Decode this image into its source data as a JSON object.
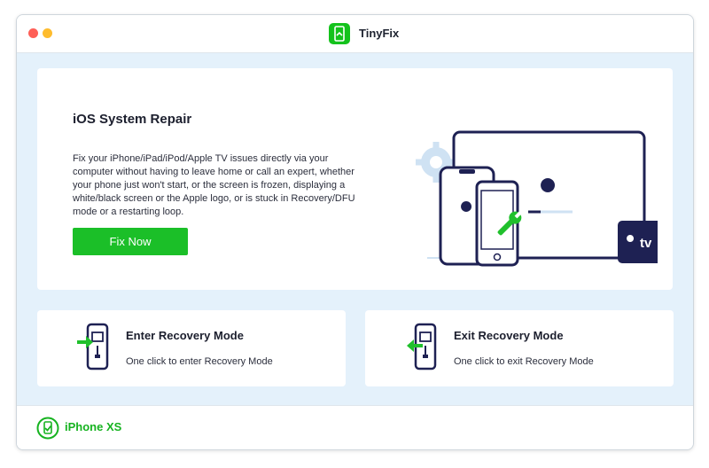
{
  "app": {
    "title": "TinyFix",
    "accent": "#1bbf28"
  },
  "main": {
    "title": "iOS System Repair",
    "description": "Fix your iPhone/iPad/iPod/Apple TV issues directly via your computer without having to leave home or call an expert, whether your phone just won't start, or the screen is frozen, displaying a white/black screen or the Apple logo, or is stuck in Recovery/DFU mode or a restarting loop.",
    "button_label": "Fix Now",
    "illustration": {
      "tv_label": "tv"
    }
  },
  "modes": {
    "enter": {
      "title": "Enter Recovery Mode",
      "subtitle": "One click to enter Recovery Mode",
      "icon": "enter-recovery-icon"
    },
    "exit": {
      "title": "Exit Recovery Mode",
      "subtitle": "One click to exit Recovery Mode",
      "icon": "exit-recovery-icon"
    }
  },
  "footer": {
    "device_name": "iPhone XS",
    "icon": "device-connected-icon"
  }
}
